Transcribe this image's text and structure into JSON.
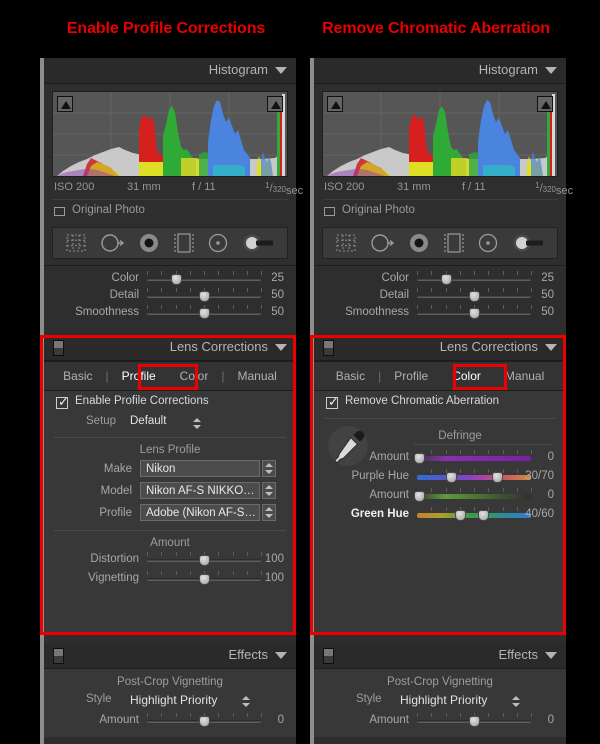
{
  "headings": {
    "left": "Enable Profile Corrections",
    "right": "Remove Chromatic Aberration"
  },
  "histogram": {
    "title": "Histogram",
    "exif": {
      "iso": "ISO 200",
      "focal": "31 mm",
      "aperture": "f / 11",
      "shutter_num": "1",
      "shutter_den": "320",
      "shutter_unit": "sec"
    },
    "original_photo": "Original Photo"
  },
  "tools": [
    {
      "name": "crop-overlay-tool"
    },
    {
      "name": "spot-removal-tool"
    },
    {
      "name": "red-eye-correction-tool"
    },
    {
      "name": "graduated-filter-tool"
    },
    {
      "name": "radial-filter-tool"
    },
    {
      "name": "adjustment-brush-tool"
    }
  ],
  "noise_reduction": {
    "rows": [
      {
        "label": "Color",
        "value": "25",
        "pos": 25
      },
      {
        "label": "Detail",
        "value": "50",
        "pos": 50
      },
      {
        "label": "Smoothness",
        "value": "50",
        "pos": 50
      }
    ]
  },
  "lens": {
    "title": "Lens Corrections",
    "tabs": [
      "Basic",
      "Profile",
      "Color",
      "Manual"
    ],
    "left": {
      "active_tab": "Profile",
      "enable_label": "Enable Profile Corrections",
      "setup_label": "Setup",
      "setup_value": "Default",
      "lens_profile_title": "Lens Profile",
      "fields": [
        {
          "label": "Make",
          "value": "Nikon"
        },
        {
          "label": "Model",
          "value": "Nikon AF-S NIKKO…"
        },
        {
          "label": "Profile",
          "value": "Adobe (Nikon AF-S…"
        }
      ],
      "amount_title": "Amount",
      "sliders": [
        {
          "label": "Distortion",
          "value": "100",
          "pos": 50
        },
        {
          "label": "Vignetting",
          "value": "100",
          "pos": 50
        }
      ]
    },
    "right": {
      "active_tab": "Color",
      "enable_label": "Remove Chromatic Aberration",
      "defringe_title": "Defringe",
      "sliders": [
        {
          "label": "Amount",
          "value": "0",
          "pos": 2,
          "grad": "purple",
          "dual": false,
          "hi": false
        },
        {
          "label": "Purple Hue",
          "value": "30/70",
          "pos": 30,
          "pos2": 70,
          "grad": "purplehue",
          "dual": true,
          "hi": false
        },
        {
          "label": "Amount",
          "value": "0",
          "pos": 2,
          "grad": "green",
          "dual": false,
          "hi": false
        },
        {
          "label": "Green Hue",
          "value": "40/60",
          "pos": 40,
          "pos2": 60,
          "grad": "greenhue",
          "dual": true,
          "hi": true
        }
      ]
    }
  },
  "effects": {
    "title": "Effects",
    "group_title": "Post-Crop Vignetting",
    "style_label": "Style",
    "style_value": "Highlight Priority",
    "amount": {
      "label": "Amount",
      "value": "0",
      "pos": 50
    }
  },
  "colors": {
    "accent_red": "#ee0000",
    "panel_bg": "#2e2e2e",
    "body_bg": "#383838",
    "text": "#b4b4b4"
  }
}
